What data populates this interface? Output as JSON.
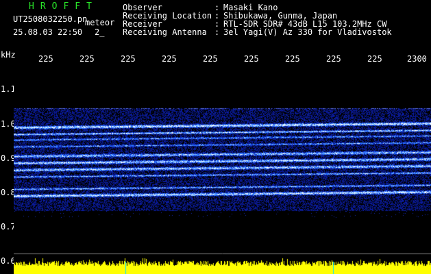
{
  "header": {
    "app_name": "HROFFT",
    "file_name": "UT2508032250.pn",
    "mode": "meteor",
    "datetime": "25.08.03 22:50",
    "extra": "2_"
  },
  "station": {
    "rows": [
      {
        "label": "Observer",
        "sep": ":",
        "value": "Masaki Kano"
      },
      {
        "label": "Receiving Location",
        "sep": ":",
        "value": "Shibukawa, Gunma, Japan"
      },
      {
        "label": "Receiver",
        "sep": ":",
        "value": "RTL-SDR SDR# 43dB L15 103.2MHz CW"
      },
      {
        "label": "Receiving Antenna",
        "sep": ":",
        "value": "3el Yagi(V) Az 330 for Vladivostok"
      }
    ]
  },
  "axis": {
    "unit": "kHz",
    "x_ticks": [
      "225",
      "225",
      "225",
      "225",
      "225",
      "225",
      "225",
      "225",
      "225",
      "2300"
    ],
    "y_ticks": [
      "1.1",
      "1.0",
      "0.9",
      "0.8",
      "0.7",
      "0.6"
    ]
  },
  "colors": {
    "background": "#000000",
    "app_name": "#29e629",
    "text": "#ffffff",
    "echo_low": "#0a1a9a",
    "echo_mid": "#3a7dff",
    "echo_high": "#ffffff",
    "noise_bar": "#ffff00",
    "marker": "#00e5ff"
  }
}
